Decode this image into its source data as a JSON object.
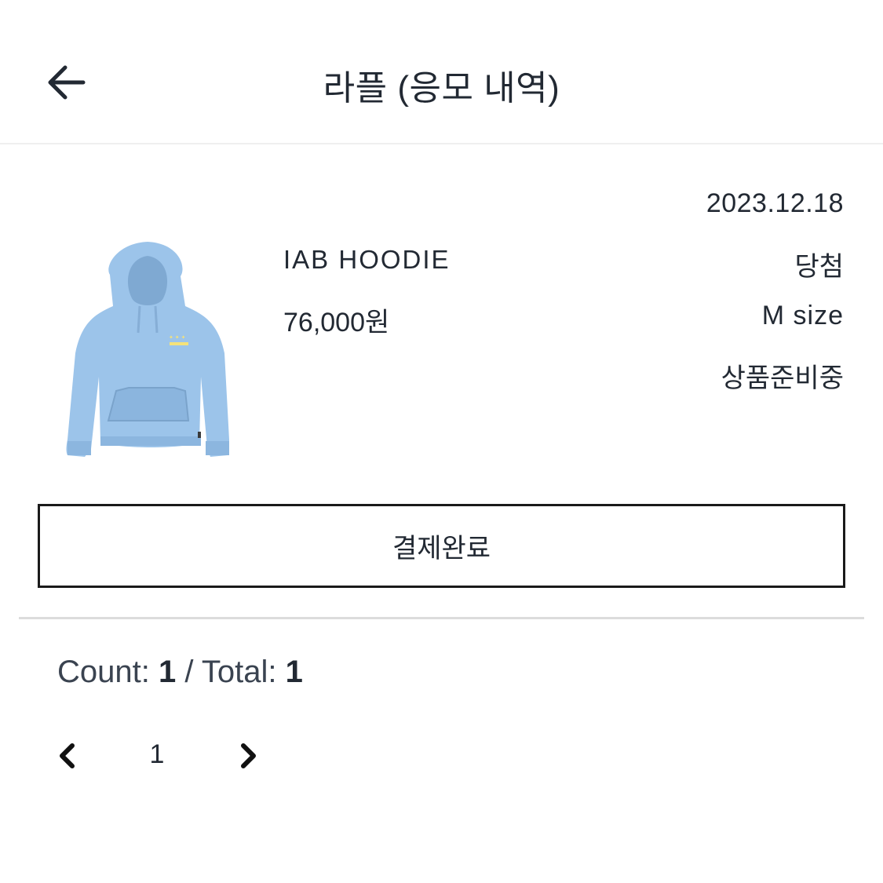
{
  "header": {
    "title": "라플 (응모 내역)",
    "back_icon": "arrow-left-icon"
  },
  "item": {
    "image_icon": "hoodie-image",
    "image_color": "#9cc4ea",
    "name": "IAB HOODIE",
    "price": "76,000원",
    "date": "2023.12.18",
    "result": "당첨",
    "size": "M size",
    "status": "상품준비중"
  },
  "action": {
    "button_label": "결제완료"
  },
  "summary": {
    "count_label": "Count:",
    "count_value": "1",
    "separator": "/",
    "total_label": "Total:",
    "total_value": "1"
  },
  "pagination": {
    "prev_icon": "chevron-left-icon",
    "current_page": "1",
    "next_icon": "chevron-right-icon"
  }
}
